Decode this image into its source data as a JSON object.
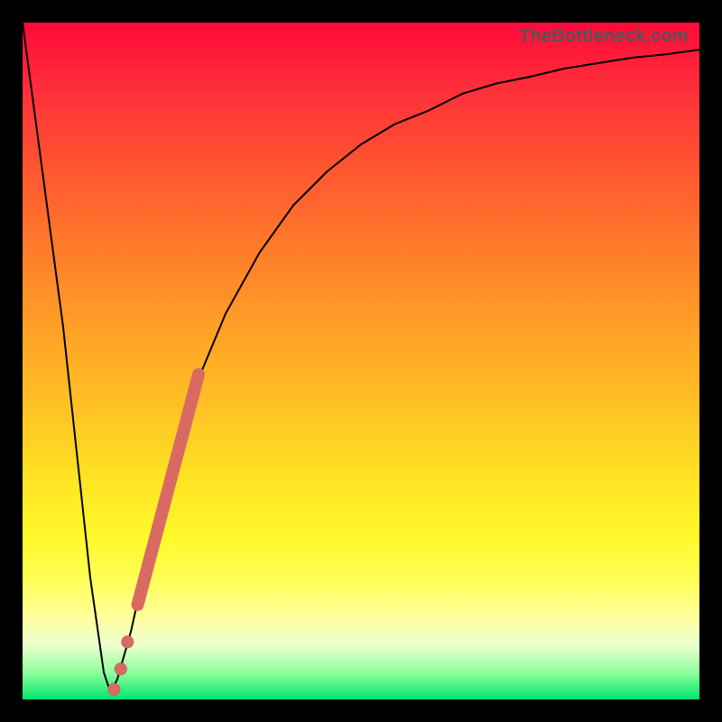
{
  "watermark": "TheBottleneck.com",
  "colors": {
    "accent_dots": "#d86a63",
    "curve": "#000000",
    "frame": "#000000"
  },
  "chart_data": {
    "type": "line",
    "title": "",
    "xlabel": "",
    "ylabel": "",
    "xlim": [
      0,
      100
    ],
    "ylim": [
      0,
      100
    ],
    "grid": false,
    "series": [
      {
        "name": "bottleneck-curve",
        "x": [
          0,
          6,
          10,
          12,
          13,
          14,
          16,
          20,
          25,
          30,
          35,
          40,
          45,
          50,
          55,
          60,
          65,
          70,
          75,
          80,
          85,
          90,
          95,
          100
        ],
        "y": [
          100,
          55,
          18,
          4,
          1,
          3,
          10,
          28,
          45,
          57,
          66,
          73,
          78,
          82,
          85,
          87,
          89.5,
          91,
          92,
          93.2,
          94,
          94.8,
          95.3,
          96
        ]
      }
    ],
    "markers": [
      {
        "name": "highlight-segment",
        "type": "segment",
        "x0": 17,
        "y0": 14,
        "x1": 26,
        "y1": 48
      },
      {
        "name": "dot-1",
        "type": "dot",
        "x": 15.5,
        "y": 8.5
      },
      {
        "name": "dot-2",
        "type": "dot",
        "x": 14.5,
        "y": 4.5
      },
      {
        "name": "dot-3",
        "type": "dot",
        "x": 13.5,
        "y": 1.5
      }
    ]
  }
}
